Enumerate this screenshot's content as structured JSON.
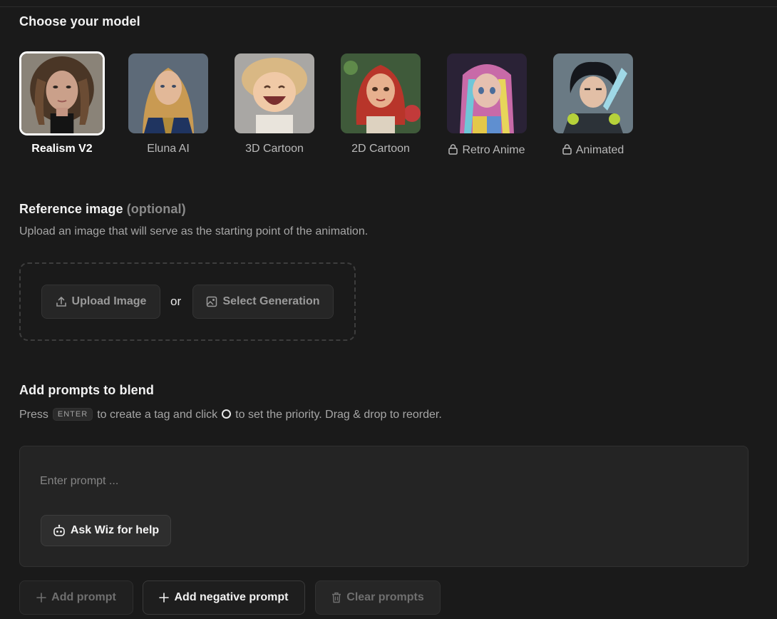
{
  "model_section": {
    "title": "Choose your model",
    "models": [
      {
        "label": "Realism V2",
        "selected": true,
        "locked": false
      },
      {
        "label": "Eluna AI",
        "selected": false,
        "locked": false
      },
      {
        "label": "3D Cartoon",
        "selected": false,
        "locked": false
      },
      {
        "label": "2D Cartoon",
        "selected": false,
        "locked": false
      },
      {
        "label": "Retro Anime",
        "selected": false,
        "locked": true
      },
      {
        "label": "Animated",
        "selected": false,
        "locked": true
      }
    ]
  },
  "reference_section": {
    "title": "Reference image",
    "optional_label": "(optional)",
    "subtitle": "Upload an image that will serve as the starting point of the animation.",
    "upload_label": "Upload Image",
    "or_label": "or",
    "select_label": "Select Generation"
  },
  "prompts_section": {
    "title": "Add prompts to blend",
    "help_press": "Press",
    "help_key": "ENTER",
    "help_mid": "to create a tag and click",
    "help_end": "to set the priority. Drag & drop to reorder.",
    "input_placeholder": "Enter prompt ...",
    "input_value": "",
    "wiz_label": "Ask Wiz for help"
  },
  "actions": {
    "add_prompt": "Add prompt",
    "add_negative": "Add negative prompt",
    "clear_prompts": "Clear prompts"
  },
  "colors": {
    "background": "#1a1a1a",
    "panel": "#242424",
    "selected_border": "#ffffff",
    "muted_text": "#8a8a8a"
  }
}
